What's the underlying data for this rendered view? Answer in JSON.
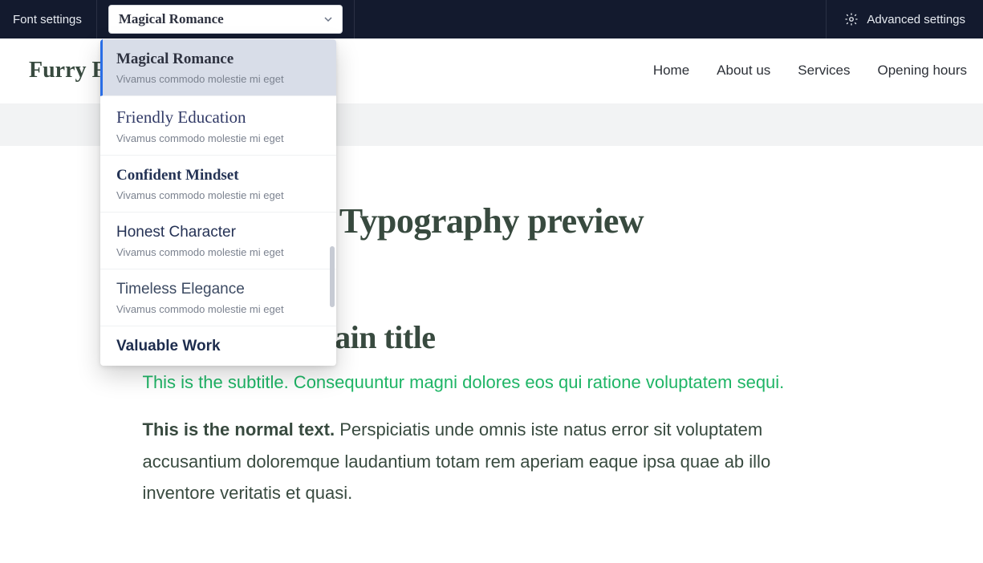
{
  "topbar": {
    "label": "Font settings",
    "advanced": "Advanced settings",
    "selected": "Magical Romance"
  },
  "dropdown": {
    "sample_text": "Vivamus commodo molestie mi eget",
    "options": [
      {
        "name": "Magical Romance",
        "style": "style-serif-bold",
        "selected": true
      },
      {
        "name": "Friendly Education",
        "style": "style-serif",
        "selected": false
      },
      {
        "name": "Confident Mindset",
        "style": "style-slab-bold",
        "selected": false
      },
      {
        "name": "Honest Character",
        "style": "style-sans-light",
        "selected": false
      },
      {
        "name": "Timeless Elegance",
        "style": "style-system",
        "selected": false
      },
      {
        "name": "Valuable Work",
        "style": "style-sans-bold",
        "selected": false
      }
    ]
  },
  "site": {
    "title": "Furry Fo"
  },
  "nav": {
    "items": [
      "Home",
      "About us",
      "Services",
      "Opening hours"
    ]
  },
  "preview": {
    "heading": "Typography preview",
    "main_title_fragment": "e main title",
    "subtitle": "This is the subtitle. Consequuntur magni dolores eos qui ratione voluptatem sequi.",
    "body_bold": "This is the normal text.",
    "body_rest": " Perspiciatis unde omnis iste natus error sit voluptatem accusantium doloremque laudantium totam rem aperiam eaque ipsa quae ab illo inventore veritatis et quasi."
  },
  "colors": {
    "topbar_bg": "#131a2e",
    "accent_blue": "#2a6ee6",
    "heading_green": "#384a3f",
    "subtitle_green": "#1fb566"
  }
}
